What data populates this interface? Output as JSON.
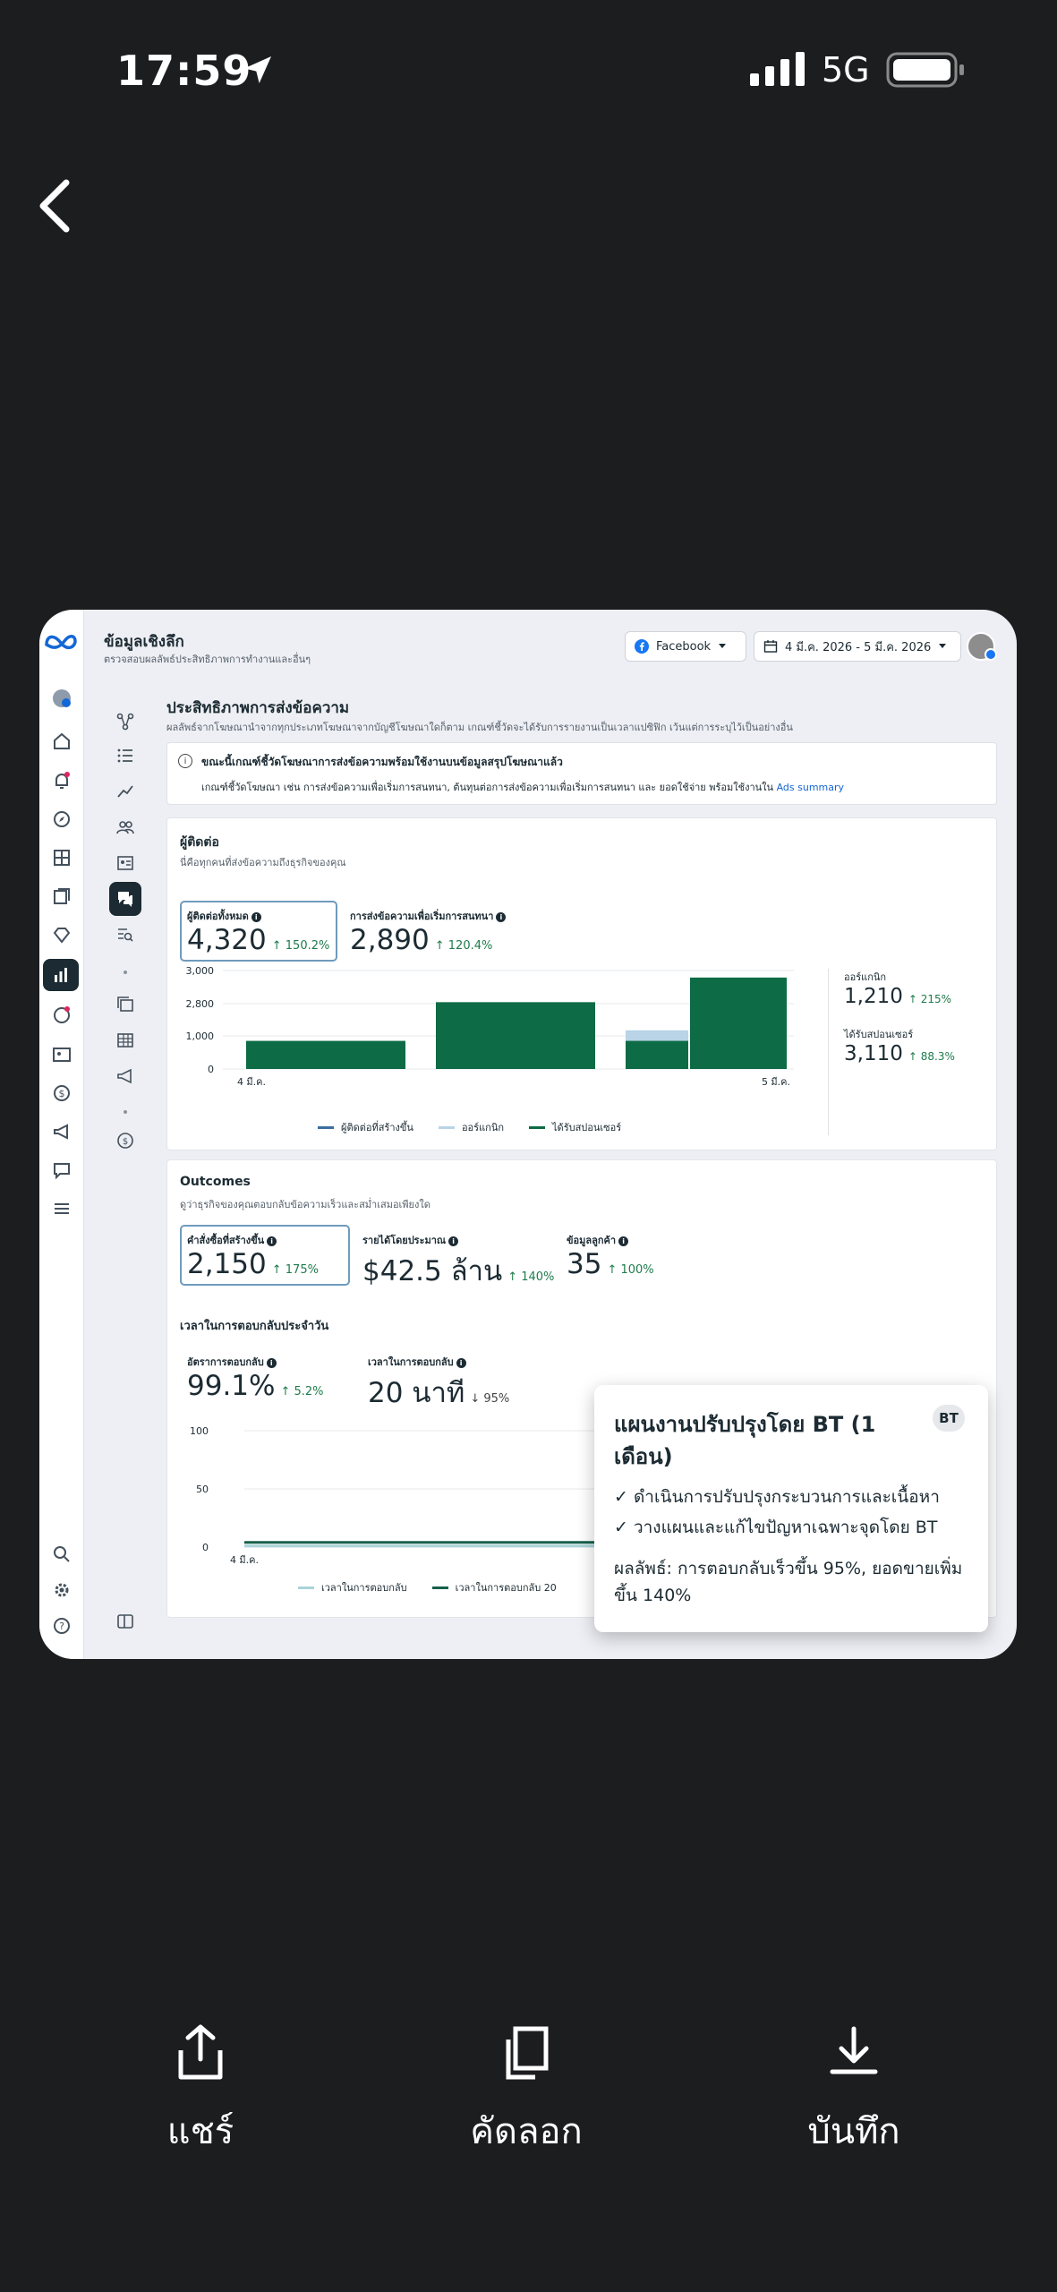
{
  "status_bar": {
    "time": "17:59",
    "network": "5G"
  },
  "header": {
    "title": "ข้อมูลเชิงลึก",
    "subtitle": "ตรวจสอบผลลัพธ์ประสิทธิภาพการทำงานและอื่นๆ",
    "platform": "Facebook",
    "date_range": "4 มี.ค. 2026 - 5 มี.ค. 2026"
  },
  "section": {
    "title": "ประสิทธิภาพการส่งข้อความ",
    "subtitle": "ผลลัพธ์จากโฆษณานำจากทุกประเภทโฆษณาจากบัญชีโฆษณาใดก็ตาม เกณฑ์ชี้วัดจะได้รับการรายงานเป็นเวลาแปซิฟิก เว้นแต่การระบุไว้เป็นอย่างอื่น"
  },
  "notice": {
    "title": "ขณะนี้เกณฑ์ชี้วัดโฆษณาการส่งข้อความพร้อมใช้งานบนข้อมูลสรุปโฆษณาแล้ว",
    "body": "เกณฑ์ชี้วัดโฆษณา เช่น การส่งข้อความเพื่อเริ่มการสนทนา, ต้นทุนต่อการส่งข้อความเพื่อเริ่มการสนทนา และ ยอดใช้จ่าย พร้อมใช้งานใน",
    "link": "Ads summary"
  },
  "contacts_card": {
    "title": "ผู้ติดต่อ",
    "subtitle": "นี่คือทุกคนที่ส่งข้อความถึงธุรกิจของคุณ",
    "metrics": [
      {
        "label": "ผู้ติดต่อทั้งหมด",
        "value": "4,320",
        "change": "↑ 150.2%"
      },
      {
        "label": "การส่งข้อความเพื่อเริ่มการสนทนา",
        "value": "2,890",
        "change": "↑ 120.4%"
      }
    ],
    "side_metrics": [
      {
        "label": "ออร์แกนิก",
        "value": "1,210",
        "change": "↑ 215%"
      },
      {
        "label": "ได้รับสปอนเซอร์",
        "value": "3,110",
        "change": "↑ 88.3%"
      }
    ]
  },
  "chart_data": [
    {
      "type": "bar",
      "title": "",
      "x_tick_labels": [
        "4 มี.ค.",
        "5 มี.ค."
      ],
      "y_tick_labels": [
        "3,000",
        "2,800",
        "1,000",
        "0"
      ],
      "legend_position": "bottom",
      "series": [
        {
          "name": "ผู้ติดต่อที่สร้างขึ้น",
          "color": "#3b6ea0"
        },
        {
          "name": "ออร์แกนิก",
          "color": "#b8d4e6"
        },
        {
          "name": "ได้รับสปอนเซอร์",
          "color": "#0d6b45"
        }
      ],
      "bars": [
        {
          "group": 1,
          "series": "ได้รับสปอนเซอร์",
          "value": 800
        },
        {
          "group": 2,
          "series": "ได้รับสปอนเซอร์",
          "value": 1900
        },
        {
          "group": 3,
          "series": "ออร์แกนิก",
          "value": 1100
        },
        {
          "group": 3,
          "series": "ได้รับสปอนเซอร์",
          "value": 800
        },
        {
          "group": 4,
          "series": "ได้รับสปอนเซอร์",
          "value": 2600
        }
      ]
    },
    {
      "type": "line",
      "title": "",
      "x_tick_labels": [
        "4 มี.ค."
      ],
      "y_tick_labels": [
        "100",
        "50",
        "0"
      ],
      "ylim": [
        0,
        100
      ],
      "legend_position": "bottom",
      "series": [
        {
          "name": "เวลาในการตอบกลับ",
          "color": "#a9d4d8",
          "values": [
            1,
            1
          ]
        },
        {
          "name": "เวลาในการตอบกลับ 20",
          "color": "#16604a",
          "values": [
            4,
            4
          ]
        }
      ]
    }
  ],
  "outcomes_card": {
    "title": "Outcomes",
    "subtitle": "ดูว่าธุรกิจของคุณตอบกลับข้อความเร็วและสม่ำเสมอเพียงใด",
    "metrics": [
      {
        "label": "คำสั่งซื้อที่สร้างขึ้น",
        "value": "2,150",
        "change": "↑ 175%"
      },
      {
        "label": "รายได้โดยประมาณ",
        "value": "$42.5 ล้าน",
        "change": "↑ 140%"
      },
      {
        "label": "ข้อมูลลูกค้า",
        "value": "35",
        "change": "↑ 100%"
      }
    ],
    "response_title": "เวลาในการตอบกลับประจำวัน",
    "response_metrics": [
      {
        "label": "อัตราการตอบกลับ",
        "value": "99.1%",
        "change": "↑ 5.2%"
      },
      {
        "label": "เวลาในการตอบกลับ",
        "value": "20 นาที",
        "change": "↓ 95%"
      }
    ]
  },
  "popup": {
    "title": "แผนงานปรับปรุงโดย BT (1 เดือน)",
    "badge": "BT",
    "items": [
      "✓ ดำเนินการปรับปรุงกระบวนการและเนื้อหา",
      "✓ วางแผนและแก้ไขปัญหาเฉพาะจุดโดย BT"
    ],
    "result": "ผลลัพธ์: การตอบกลับเร็วขึ้น 95%, ยอดขายเพิ่มขึ้น 140%"
  },
  "actions": {
    "share": "แชร์",
    "copy": "คัดลอก",
    "save": "บันทึก"
  },
  "icons": [
    "location-arrow-icon",
    "signal-icon",
    "battery-icon",
    "back-chevron-icon",
    "meta-logo-icon",
    "facebook-icon",
    "calendar-icon",
    "share-icon",
    "copy-icon",
    "download-icon"
  ]
}
